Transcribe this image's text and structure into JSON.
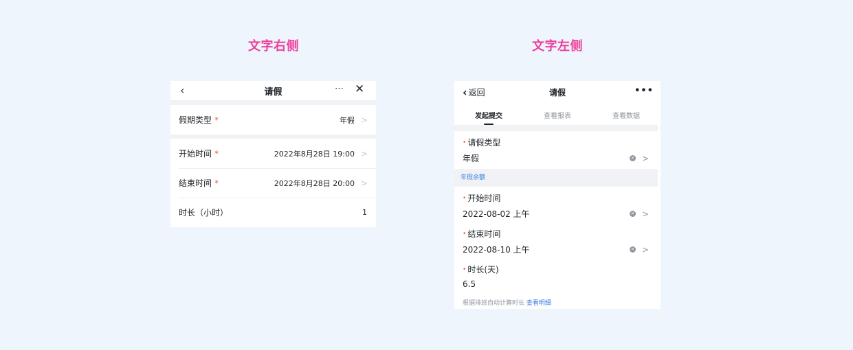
{
  "headings": {
    "left": "文字右侧",
    "right": "文字左侧"
  },
  "phone_a": {
    "title": "请假",
    "rows": [
      {
        "label": "假期类型",
        "value": "年假"
      },
      {
        "label": "开始时间",
        "value": "2022年8月28日 19:00"
      },
      {
        "label": "结束时间",
        "value": "2022年8月28日 20:00"
      },
      {
        "label": "时长（小时）",
        "value": "1"
      }
    ]
  },
  "phone_b": {
    "back_label": "返回",
    "title": "请假",
    "tabs": [
      "发起提交",
      "查看报表",
      "查看数据"
    ],
    "fields": {
      "leave_type": {
        "label": "请假类型",
        "value": "年假"
      },
      "start": {
        "label": "开始时间",
        "value": "2022-08-02 上午"
      },
      "end": {
        "label": "结束时间",
        "value": "2022-08-10 上午"
      },
      "duration": {
        "label": "时长(天)",
        "value": "6.5"
      }
    },
    "balance_label": "年假余额",
    "hint_text": "根据排班自动计算时长",
    "hint_link": "查看明细"
  },
  "colors": {
    "background": "#eff5fc",
    "heading": "#ee3f9c",
    "required": "#f05a3c",
    "link": "#3b7fe8"
  },
  "icons": [
    "back-chevron-icon",
    "more-icon",
    "close-icon",
    "chevron-right-icon",
    "clear-icon"
  ]
}
